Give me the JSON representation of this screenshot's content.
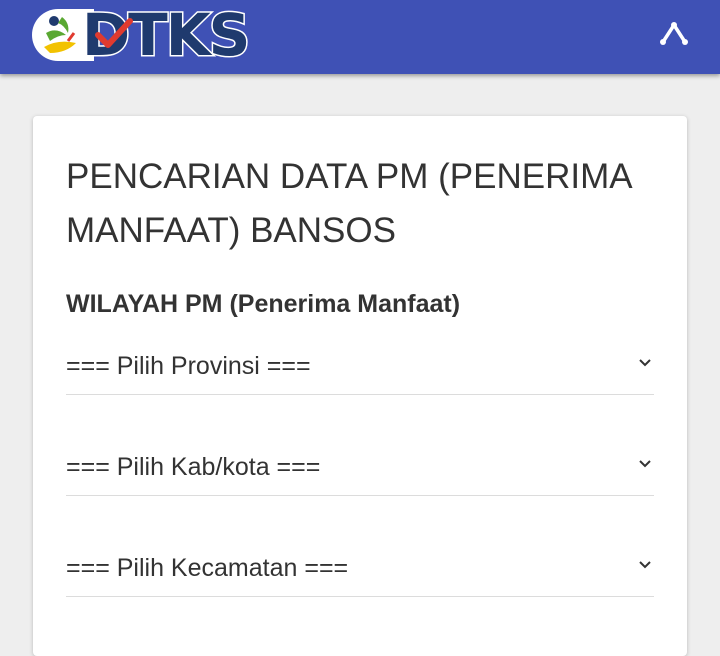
{
  "header": {
    "logo_text": "DTKS",
    "brand_color": "#3f51b5",
    "menu_icon": "collapse-arrow-icon"
  },
  "form": {
    "title": "PENCARIAN DATA PM (PENERIMA MANFAAT) BANSOS",
    "section_label": "WILAYAH PM (Penerima Manfaat)",
    "selects": [
      {
        "value": "=== Pilih Provinsi ==="
      },
      {
        "value": "=== Pilih Kab/kota ==="
      },
      {
        "value": "=== Pilih Kecamatan ==="
      }
    ]
  }
}
